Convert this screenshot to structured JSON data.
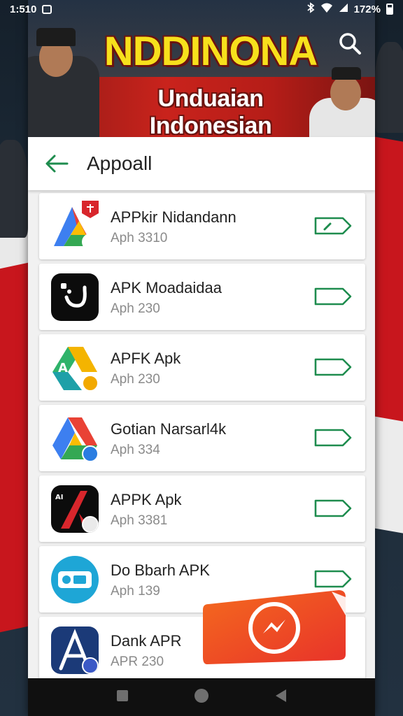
{
  "status_bar": {
    "time": "1:510",
    "battery_text": "172%",
    "icons": [
      "notification-icon",
      "bluetooth-icon",
      "wifi-icon",
      "signal-icon",
      "battery-icon"
    ]
  },
  "banner": {
    "title": "NDDINONA",
    "subtitle": "Unduaian Indonesian"
  },
  "appbar": {
    "title": "Appoall"
  },
  "apps": [
    {
      "name": "APPkir Nidandann",
      "version": "Aph 3310"
    },
    {
      "name": "APK Moadaidaa",
      "version": "Aph 230"
    },
    {
      "name": "APFK Apk",
      "version": "Aph 230"
    },
    {
      "name": "Gotian Narsarl4k",
      "version": "Aph 334"
    },
    {
      "name": "APPK Apk",
      "version": "Aph 3381"
    },
    {
      "name": "Do Bbarh APK",
      "version": "Aph 139"
    },
    {
      "name": "Dank APR",
      "version": "APR 230"
    }
  ],
  "colors": {
    "accent_green": "#1e8c4e",
    "banner_red": "#c9231c",
    "banner_yellow": "#f7e01c",
    "sticker_orange": "#f05a22"
  }
}
